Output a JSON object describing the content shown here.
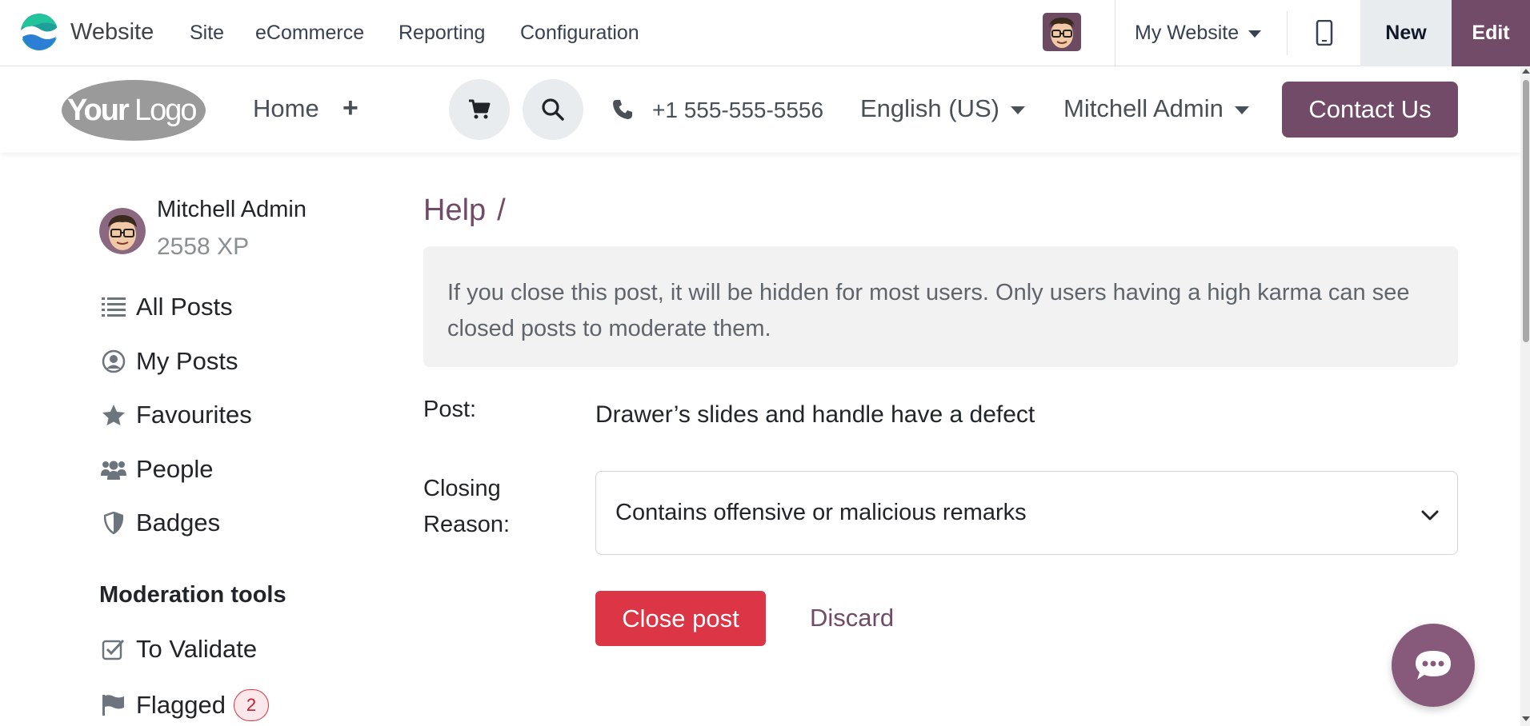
{
  "adminbar": {
    "app_name": "Website",
    "menu": [
      "Site",
      "eCommerce",
      "Reporting",
      "Configuration"
    ],
    "website_selector": "My Website",
    "new_label": "New",
    "edit_label": "Edit"
  },
  "header": {
    "logo_text": "YourLogo",
    "home": "Home",
    "plus": "+",
    "phone": "+1 555-555-5556",
    "language": "English (US)",
    "user": "Mitchell Admin",
    "contact": "Contact Us"
  },
  "profile": {
    "name": "Mitchell Admin",
    "xp": "2558 XP"
  },
  "sidebar": {
    "items": [
      {
        "label": "All Posts",
        "icon": "list-icon"
      },
      {
        "label": "My Posts",
        "icon": "user-circle-icon"
      },
      {
        "label": "Favourites",
        "icon": "star-icon"
      },
      {
        "label": "People",
        "icon": "users-icon"
      },
      {
        "label": "Badges",
        "icon": "shield-icon"
      }
    ],
    "moderation_heading": "Moderation tools",
    "moderation_items": [
      {
        "label": "To Validate",
        "icon": "check-square-icon"
      },
      {
        "label": "Flagged",
        "icon": "flag-icon",
        "count": "2"
      }
    ]
  },
  "main": {
    "breadcrumb": "Help",
    "breadcrumb_sep": "/",
    "info": "If you close this post, it will be hidden for most users. Only users having a high karma can see closed posts to moderate them.",
    "post_label": "Post:",
    "post_value": "Drawer’s slides and handle have a defect",
    "reason_label_1": "Closing",
    "reason_label_2": "Reason:",
    "reason_value": "Contains offensive or malicious remarks",
    "close_button": "Close post",
    "discard_button": "Discard"
  },
  "colors": {
    "brand": "#714b67",
    "danger": "#dc3545",
    "chat": "#875a7b"
  }
}
